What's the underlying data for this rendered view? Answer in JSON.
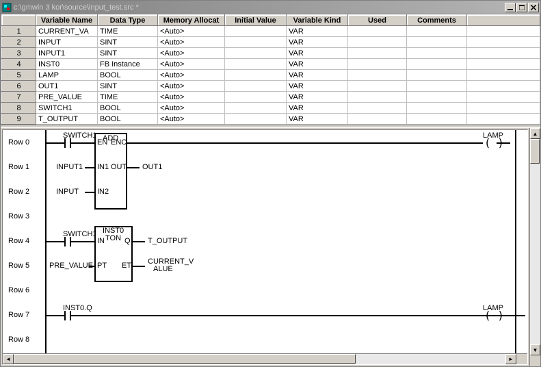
{
  "window": {
    "title": "c:\\gmwin 3 kor\\source\\input_test.src *"
  },
  "grid": {
    "headers": [
      "",
      "Variable Name",
      "Data Type",
      "Memory Allocat",
      "Initial Value",
      "Variable Kind",
      "Used",
      "Comments"
    ],
    "rows": [
      {
        "n": "1",
        "name": "CURRENT_VA",
        "type": "TIME",
        "mem": "<Auto>",
        "init": "",
        "kind": "VAR",
        "used": "",
        "cmt": ""
      },
      {
        "n": "2",
        "name": "INPUT",
        "type": "SINT",
        "mem": "<Auto>",
        "init": "",
        "kind": "VAR",
        "used": "",
        "cmt": ""
      },
      {
        "n": "3",
        "name": "INPUT1",
        "type": "SINT",
        "mem": "<Auto>",
        "init": "",
        "kind": "VAR",
        "used": "",
        "cmt": ""
      },
      {
        "n": "4",
        "name": "INST0",
        "type": "FB Instance",
        "mem": "<Auto>",
        "init": "",
        "kind": "VAR",
        "used": "",
        "cmt": ""
      },
      {
        "n": "5",
        "name": "LAMP",
        "type": "BOOL",
        "mem": "<Auto>",
        "init": "",
        "kind": "VAR",
        "used": "",
        "cmt": ""
      },
      {
        "n": "6",
        "name": "OUT1",
        "type": "SINT",
        "mem": "<Auto>",
        "init": "",
        "kind": "VAR",
        "used": "",
        "cmt": ""
      },
      {
        "n": "7",
        "name": "PRE_VALUE",
        "type": "TIME",
        "mem": "<Auto>",
        "init": "",
        "kind": "VAR",
        "used": "",
        "cmt": ""
      },
      {
        "n": "8",
        "name": "SWITCH1",
        "type": "BOOL",
        "mem": "<Auto>",
        "init": "",
        "kind": "VAR",
        "used": "",
        "cmt": ""
      },
      {
        "n": "9",
        "name": "T_OUTPUT",
        "type": "BOOL",
        "mem": "<Auto>",
        "init": "",
        "kind": "VAR",
        "used": "",
        "cmt": ""
      }
    ]
  },
  "ladder": {
    "rowlabels": [
      "Row 0",
      "Row 1",
      "Row 2",
      "Row 3",
      "Row 4",
      "Row 5",
      "Row 6",
      "Row 7",
      "Row 8"
    ],
    "block1": {
      "title": "ADD",
      "en": "EN",
      "eno": "ENO",
      "in1": "IN1",
      "in2": "IN2",
      "out": "OUT"
    },
    "block2": {
      "inst": "INST0",
      "title": "TON",
      "in": "IN",
      "q": "Q",
      "pt": "PT",
      "et": "ET"
    },
    "sig": {
      "switch1": "SWITCH1",
      "input1": "INPUT1",
      "input": "INPUT",
      "out1": "OUT1",
      "pre_value": "PRE_VALUE",
      "t_output": "T_OUTPUT",
      "current_v": "CURRENT_V",
      "alue": "ALUE",
      "inst0q": "INST0.Q",
      "lamp": "LAMP"
    }
  }
}
